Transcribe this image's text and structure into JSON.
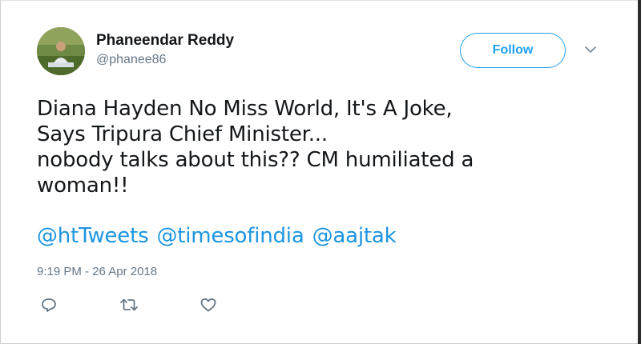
{
  "author": {
    "name": "Phaneendar Reddy",
    "handle": "@phanee86"
  },
  "follow_label": "Follow",
  "tweet": {
    "lines": [
      "Diana Hayden No Miss World, It's A Joke,",
      "Says Tripura Chief Minister...",
      "nobody talks about this?? CM humiliated a",
      "woman!!"
    ],
    "mentions": [
      "@htTweets",
      "@timesofindia",
      "@aajtak"
    ],
    "timestamp": "9:19 PM - 26 Apr 2018"
  },
  "icons": {
    "reply": "reply-icon",
    "retweet": "retweet-icon",
    "like": "heart-icon",
    "more": "chevron-down-icon"
  },
  "colors": {
    "accent": "#1da1f2",
    "link": "#1b95e0",
    "muted": "#657786"
  }
}
